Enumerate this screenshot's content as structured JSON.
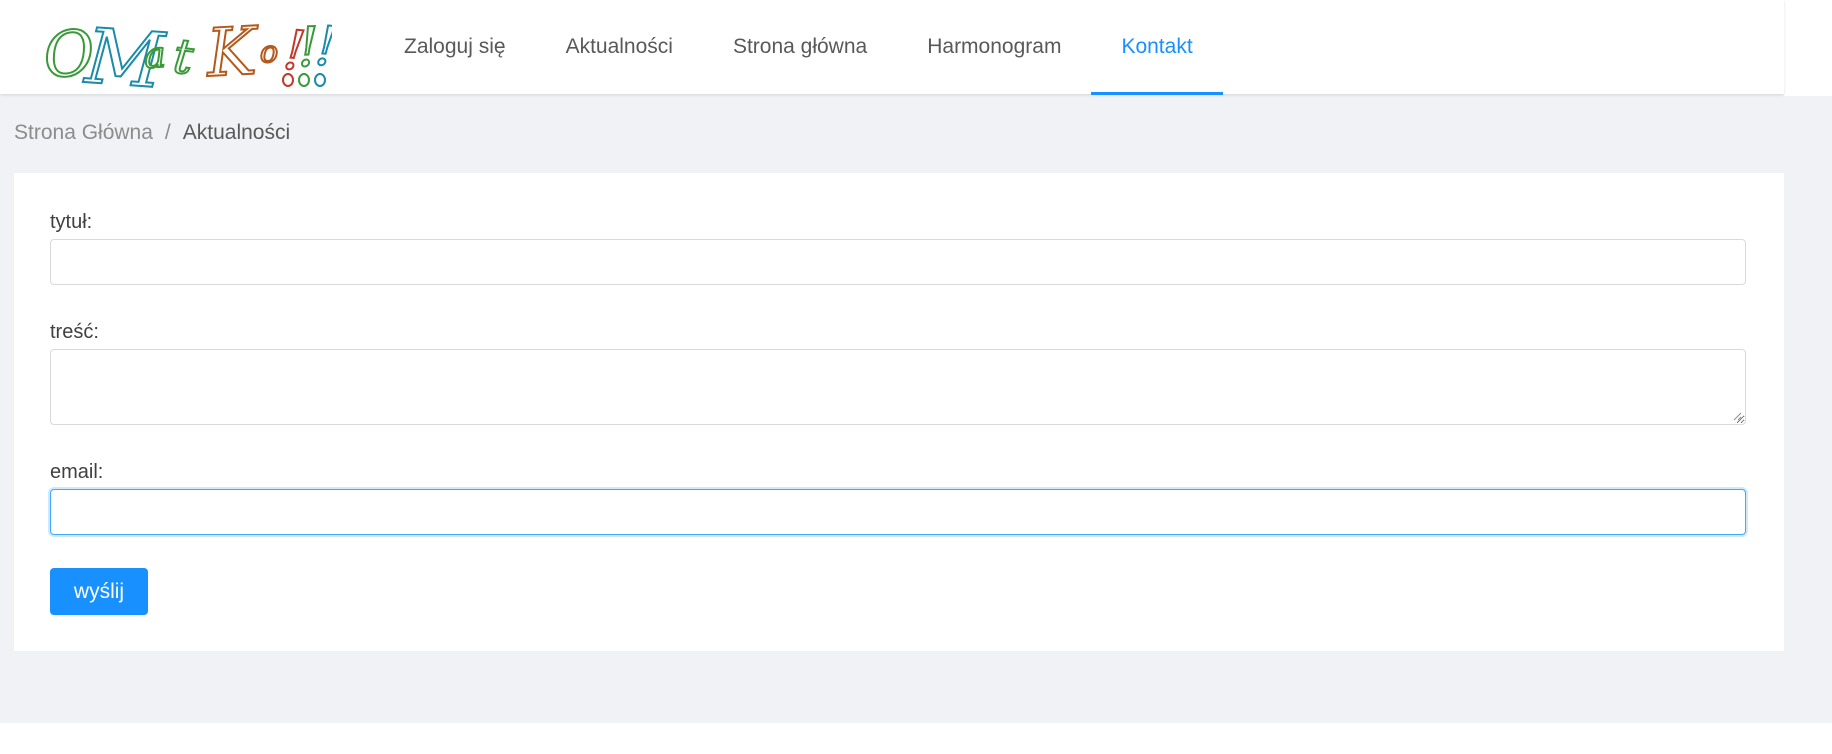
{
  "logo": {
    "letters": [
      {
        "ch": "O",
        "color": "#3a9a3a"
      },
      {
        "ch": "M",
        "color": "#1a8ba8"
      },
      {
        "ch": "a",
        "color": "#3a9a3a"
      },
      {
        "ch": "t",
        "color": "#3a9a3a"
      },
      {
        "ch": "K",
        "color": "#b4591c"
      },
      {
        "ch": "o",
        "color": "#b4591c"
      },
      {
        "ch": "!",
        "color": "#c0392b"
      },
      {
        "ch": "!",
        "color": "#3a9a3a"
      },
      {
        "ch": "!",
        "color": "#1a8ba8"
      }
    ]
  },
  "nav": {
    "items": [
      {
        "label": "Zaloguj się",
        "active": false
      },
      {
        "label": "Aktualności",
        "active": false
      },
      {
        "label": "Strona główna",
        "active": false
      },
      {
        "label": "Harmonogram",
        "active": false
      },
      {
        "label": "Kontakt",
        "active": true
      }
    ]
  },
  "breadcrumb": {
    "home": "Strona Główna",
    "separator": "/",
    "current": "Aktualności"
  },
  "form": {
    "title_label": "tytuł:",
    "title_value": "",
    "content_label": "treść:",
    "content_value": "",
    "email_label": "email:",
    "email_value": "",
    "submit_label": "wyślij"
  },
  "colors": {
    "accent": "#1890ff",
    "background": "#f0f2f5"
  }
}
